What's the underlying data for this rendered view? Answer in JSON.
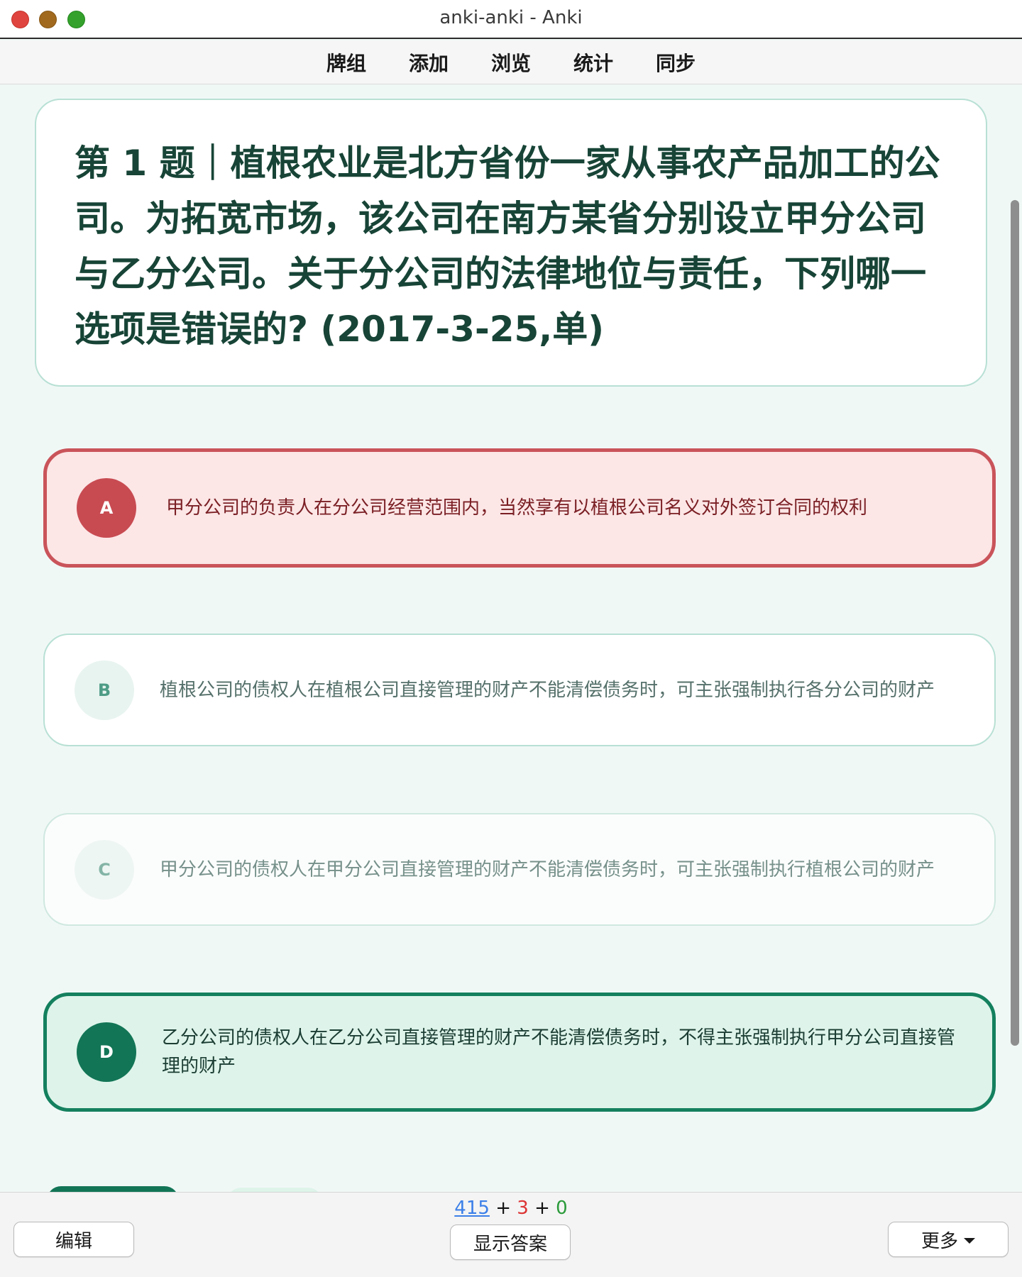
{
  "window": {
    "title": "anki-anki - Anki"
  },
  "toolbar": {
    "items": [
      "牌组",
      "添加",
      "浏览",
      "统计",
      "同步"
    ]
  },
  "question": {
    "text": "第 1 题｜植根农业是北方省份一家从事农产品加工的公司。为拓宽市场，该公司在南方某省分别设立甲分公司与乙分公司。关于分公司的法律地位与责任，下列哪一选项是错误的? (2017-3-25,单)"
  },
  "options": [
    {
      "letter": "A",
      "text": "甲分公司的负责人在分公司经营范围内，当然享有以植根公司名义对外签订合同的权利",
      "state": "wrong"
    },
    {
      "letter": "B",
      "text": "植根公司的债权人在植根公司直接管理的财产不能清偿债务时，可主张强制执行各分公司的财产",
      "state": "neutral"
    },
    {
      "letter": "C",
      "text": "甲分公司的债权人在甲分公司直接管理的财产不能清偿债务时，可主张强制执行植根公司的财产",
      "state": "neutral"
    },
    {
      "letter": "D",
      "text": "乙分公司的债权人在乙分公司直接管理的财产不能清偿债务时，不得主张强制执行甲分公司直接管理的财产",
      "state": "correct"
    }
  ],
  "bottom": {
    "edit_label": "编辑",
    "show_answer_label": "显示答案",
    "more_label": "更多",
    "counts": {
      "new": "415",
      "learn": "3",
      "review": "0",
      "sep": "+"
    }
  },
  "colors": {
    "wrong": "#c84b52",
    "correct": "#127556",
    "question_text": "#174436",
    "background": "#f0f8f6"
  }
}
